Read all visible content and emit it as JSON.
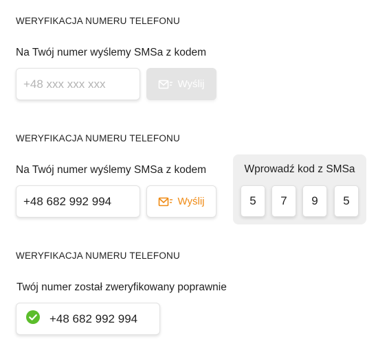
{
  "section1": {
    "title": "WERYFIKACJA NUMERU TELEFONU",
    "description": "Na Twój numer wyślemy SMSa z kodem",
    "phone_placeholder": "+48 xxx xxx xxx",
    "send_label": "Wyślij"
  },
  "section2": {
    "title": "WERYFIKACJA NUMERU TELEFONU",
    "description": "Na Twój numer wyślemy SMSa z kodem",
    "phone_value": "+48 682 992 994",
    "send_label": "Wyślij",
    "code_label": "Wprowadź kod z SMSa",
    "code_digits": [
      "5",
      "7",
      "9",
      "5"
    ]
  },
  "section3": {
    "title": "WERYFIKACJA NUMERU TELEFONU",
    "description": "Twój numer został zweryfikowany poprawnie",
    "verified_number": "+48 682 992 994"
  },
  "colors": {
    "accent": "#ef8a14",
    "success": "#5bbd2b",
    "disabled": "#e4e4e4"
  },
  "icons": {
    "send": "sms-send-icon",
    "verified": "check-circle-icon"
  }
}
